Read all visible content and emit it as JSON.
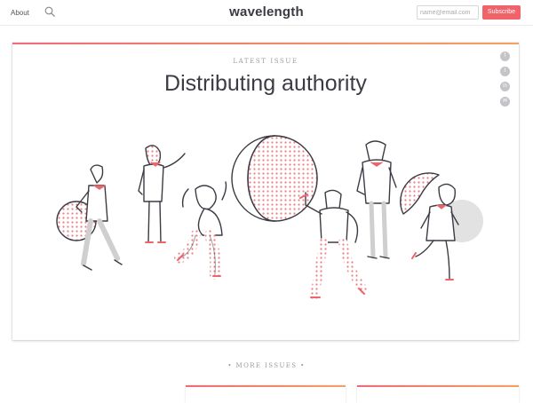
{
  "header": {
    "about_label": "About",
    "logo": "wavelength",
    "email_placeholder": "name@email.com",
    "subscribe_label": "Subscribe",
    "search_icon": "search-icon"
  },
  "featured": {
    "eyebrow": "LATEST ISSUE",
    "title": "Distributing authority"
  },
  "social": [
    {
      "name": "facebook-icon",
      "glyph": "f"
    },
    {
      "name": "twitter-icon",
      "glyph": "t"
    },
    {
      "name": "linkedin-icon",
      "glyph": "in"
    },
    {
      "name": "email-icon",
      "glyph": "✉"
    }
  ],
  "more_issues": "• MORE ISSUES •",
  "colors": {
    "accent": "#f0636b",
    "gradient_end": "#f2a262",
    "text": "#3b3b44",
    "muted": "#9a9aa0",
    "shadow_shapes": "#e0e0e0"
  }
}
